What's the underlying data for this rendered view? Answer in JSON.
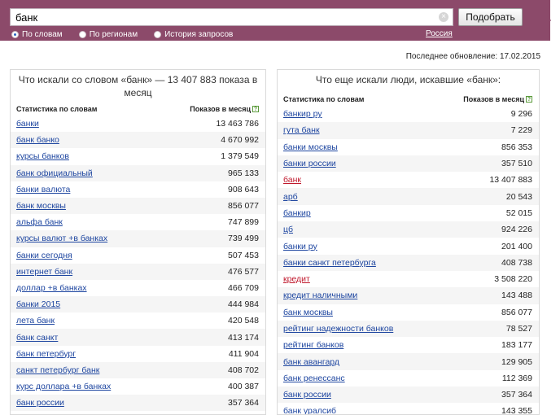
{
  "search": {
    "value": "банк",
    "submit_label": "Подобрать"
  },
  "modes": [
    {
      "label": "По словам",
      "selected": true
    },
    {
      "label": "По регионам",
      "selected": false
    },
    {
      "label": "История запросов",
      "selected": false
    }
  ],
  "region": "Россия",
  "last_update": "Последнее обновление: 17.02.2015",
  "left": {
    "title": "Что искали со словом «банк» — 13 407 883 показа в месяц",
    "col_keyword": "Статистика по словам",
    "col_count": "Показов в месяц",
    "rows": [
      {
        "kw": "банки",
        "count": "13 463 786"
      },
      {
        "kw": "банк банко",
        "count": "4 670 992"
      },
      {
        "kw": "курсы банков",
        "count": "1 379 549"
      },
      {
        "kw": "банк официальный",
        "count": "965 133"
      },
      {
        "kw": "банки валюта",
        "count": "908 643"
      },
      {
        "kw": "банк москвы",
        "count": "856 077"
      },
      {
        "kw": "альфа банк",
        "count": "747 899"
      },
      {
        "kw": "курсы валют +в банках",
        "count": "739 499"
      },
      {
        "kw": "банки сегодня",
        "count": "507 453"
      },
      {
        "kw": "интернет банк",
        "count": "476 577"
      },
      {
        "kw": "доллар +в банках",
        "count": "466 709"
      },
      {
        "kw": "банки 2015",
        "count": "444 984"
      },
      {
        "kw": "лета банк",
        "count": "420 548"
      },
      {
        "kw": "банк санкт",
        "count": "413 174"
      },
      {
        "kw": "банк петербург",
        "count": "411 904"
      },
      {
        "kw": "санкт петербург банк",
        "count": "408 702"
      },
      {
        "kw": "курс доллара +в банках",
        "count": "400 387"
      },
      {
        "kw": "банк россии",
        "count": "357 364"
      }
    ]
  },
  "right": {
    "title": "Что еще искали люди, искавшие «банк»:",
    "col_keyword": "Статистика по словам",
    "col_count": "Показов в месяц",
    "rows": [
      {
        "kw": "банкир ру",
        "count": "9 296",
        "red": false
      },
      {
        "kw": "гута банк",
        "count": "7 229",
        "red": false
      },
      {
        "kw": "банки москвы",
        "count": "856 353",
        "red": false
      },
      {
        "kw": "банки россии",
        "count": "357 510",
        "red": false
      },
      {
        "kw": "банк",
        "count": "13 407 883",
        "red": true
      },
      {
        "kw": "арб",
        "count": "20 543",
        "red": false
      },
      {
        "kw": "банкир",
        "count": "52 015",
        "red": false
      },
      {
        "kw": "цб",
        "count": "924 226",
        "red": false
      },
      {
        "kw": "банки ру",
        "count": "201 400",
        "red": false
      },
      {
        "kw": "банки санкт петербурга",
        "count": "408 738",
        "red": false
      },
      {
        "kw": "кредит",
        "count": "3 508 220",
        "red": true
      },
      {
        "kw": "кредит наличными",
        "count": "143 488",
        "red": false
      },
      {
        "kw": "банк москвы",
        "count": "856 077",
        "red": false
      },
      {
        "kw": "рейтинг надежности банков",
        "count": "78 527",
        "red": false
      },
      {
        "kw": "рейтинг банков",
        "count": "183 177",
        "red": false
      },
      {
        "kw": "банк авангард",
        "count": "129 905",
        "red": false
      },
      {
        "kw": "банк ренессанс",
        "count": "112 369",
        "red": false
      },
      {
        "kw": "банк россии",
        "count": "357 364",
        "red": false
      },
      {
        "kw": "банк уралсиб",
        "count": "143 355",
        "red": false
      }
    ]
  },
  "colors": {
    "topbar": "#8c4a6a",
    "link": "#1e46a0",
    "link_red": "#c0182c"
  }
}
